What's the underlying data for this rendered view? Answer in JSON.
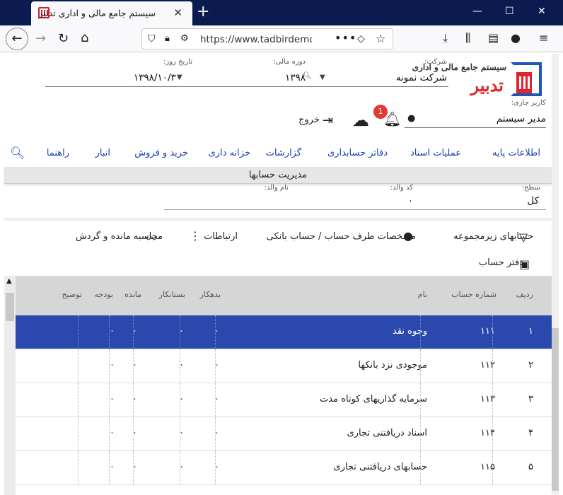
{
  "browser": {
    "tab_title": "سیستم جامع مالی و اداری تدبیر",
    "url": "https://www.tadbirdemo.c",
    "new_tab": "+",
    "minimize": "—",
    "maximize": "☐",
    "close": "✕",
    "tab_close": "✕"
  },
  "header": {
    "logo_line1": "سیستم جامع مالی و اداری",
    "logo_line2": "تدبیر",
    "company_label": "شرکت:",
    "company_value": "شرکت نمونه",
    "period_label": "دوره مالی:",
    "period_value": "۱۳۹۸",
    "date_label": "تاریخ روز:",
    "date_value": "۱۳۹۸/۱۰/۳۰",
    "user_label": "کاربر جاری:",
    "user_value": "مدیر سیستم",
    "notification_count": "1",
    "exit_label": "خروج"
  },
  "menu": {
    "items": [
      "اطلاعات پایه",
      "عملیات اسناد",
      "دفاتر حسابداری",
      "گزارشات",
      "خزانه داری",
      "خرید و فروش",
      "انبار",
      "راهنما"
    ],
    "sub_title": "مدیریت حسابها"
  },
  "filter": {
    "level_label": "سطح:",
    "level_value": "کل",
    "parent_code_label": "کد والد:",
    "parent_code_value": "۰",
    "parent_name_label": "نام والد:"
  },
  "toolbar": {
    "sub_accounts": "حسابهای زیرمجموعه",
    "counterparty": "مشخصات طرف حساب / حساب بانکی",
    "relations": "ارتباطات",
    "calc_balance": "محاسبه مانده و گردش",
    "ledger": "دفتر حساب"
  },
  "table": {
    "headers": {
      "row": "ردیف",
      "account_no": "شماره حساب",
      "name": "نام",
      "debit": "بدهکار",
      "credit": "بستانکار",
      "balance": "مانده",
      "budget": "بودجه",
      "description": "توضیح"
    },
    "rows": [
      {
        "row": "۱",
        "account_no": "۱۱۱",
        "name": "وجوه نقد",
        "debit": "۰",
        "credit": "۰",
        "balance": "۰",
        "budget": "۰"
      },
      {
        "row": "۲",
        "account_no": "۱۱۲",
        "name": "موجودی نزد بانکها",
        "debit": "۰",
        "credit": "۰",
        "balance": "۰",
        "budget": "۰"
      },
      {
        "row": "۳",
        "account_no": "۱۱۳",
        "name": "سرمایه گذاریهای کوتاه مدت",
        "debit": "۰",
        "credit": "۰",
        "balance": "۰",
        "budget": "۰"
      },
      {
        "row": "۴",
        "account_no": "۱۱۴",
        "name": "اسناد دریافتنی تجاری",
        "debit": "۰",
        "credit": "۰",
        "balance": "۰",
        "budget": "۰"
      },
      {
        "row": "۵",
        "account_no": "۱۱۵",
        "name": "حسابهای دریافتنی تجاری",
        "debit": "۰",
        "credit": "۰",
        "balance": "۰",
        "budget": "۰"
      }
    ]
  },
  "colors": {
    "accent": "#1a3fb0",
    "selected_row": "#2a48ad",
    "badge": "#e53935",
    "titlebar": "#0b1b4f"
  }
}
